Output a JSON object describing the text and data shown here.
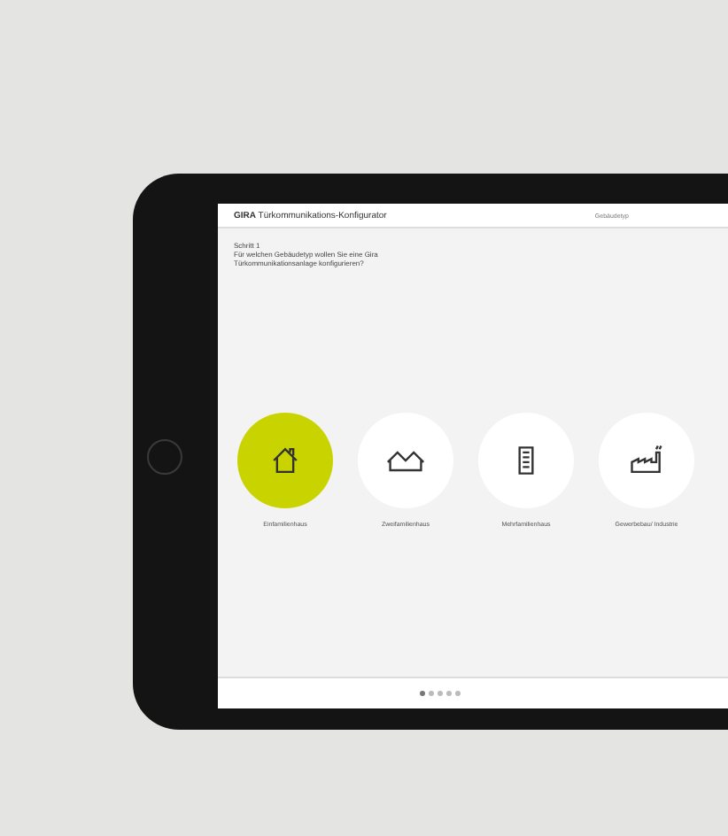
{
  "app": {
    "title": "**GIRA** Türkommunikations-Konfigurator",
    "step_tab": "Gebäudetyp"
  },
  "step": {
    "label": "Schritt 1",
    "question": "Für welchen Gebäudetyp wollen Sie eine Gira Türkommunikationsanlage konfigurieren?"
  },
  "options": [
    {
      "kind": "house",
      "label": "Einfamilienhaus",
      "selected": true
    },
    {
      "kind": "double-house",
      "label": "Zweifamilienhaus",
      "selected": false
    },
    {
      "kind": "apartment",
      "label": "Mehrfamilienhaus",
      "selected": false
    },
    {
      "kind": "factory",
      "label": "Gewerbebau/ Industrie",
      "selected": false
    }
  ],
  "pager": [
    {
      "selected": true
    },
    {
      "selected": false
    },
    {
      "selected": false
    },
    {
      "selected": false
    },
    {
      "selected": false
    }
  ]
}
